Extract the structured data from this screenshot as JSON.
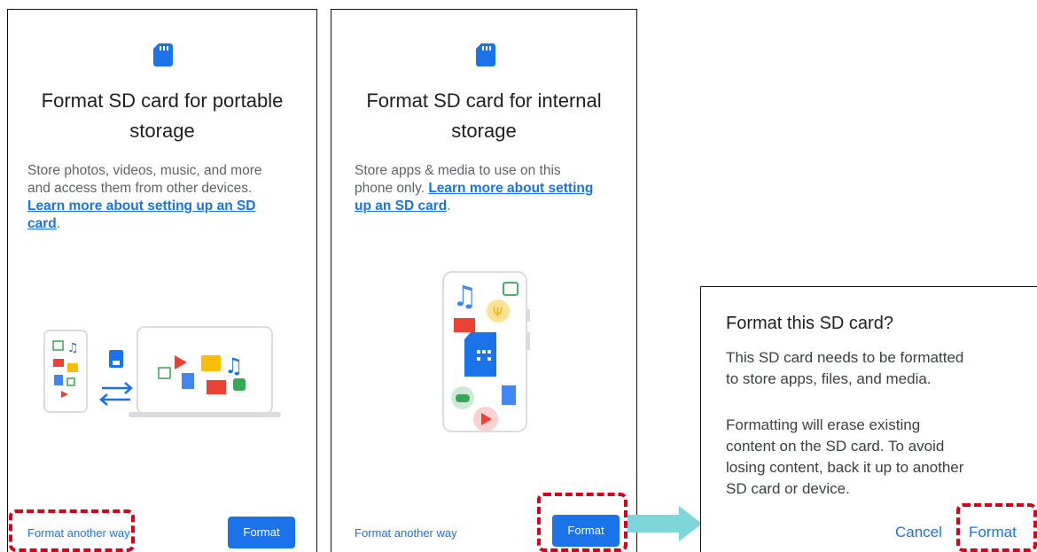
{
  "panels": {
    "portable": {
      "title_line1": "Format SD card for portable",
      "title_line2": "storage",
      "body_lines": [
        "Store photos, videos, music, and more",
        "and access them from other devices."
      ],
      "link_line1": "Learn more about setting up an SD",
      "link_line2": "card",
      "period": ".",
      "secondary_button": "Format another way",
      "primary_button": "Format"
    },
    "internal": {
      "title_line1": "Format SD card for internal",
      "title_line2": "storage",
      "body_line1": "Store apps & media to use on this",
      "body_line2_prefix": "phone only. ",
      "link_line1": "Learn more about setting",
      "link_line2": "up an SD card",
      "period": ".",
      "secondary_button": "Format another way",
      "primary_button": "Format"
    },
    "dialog": {
      "title": "Format this SD card?",
      "para1_lines": [
        "This SD card needs to be formatted",
        "to store apps, files, and media."
      ],
      "para2_lines": [
        "Formatting will erase existing",
        "content on the SD card. To avoid",
        "losing content, back it up to another",
        "SD card or device."
      ],
      "cancel_button": "Cancel",
      "format_button": "Format"
    }
  },
  "colors": {
    "accent": "#1a73e8",
    "highlight": "#d9001b",
    "arrow": "#7fd6da"
  },
  "icons": [
    "sd-card-icon",
    "music-note-icon",
    "image-icon",
    "folder-icon",
    "document-icon",
    "play-icon",
    "gamepad-icon",
    "restaurant-icon",
    "video-clip-icon",
    "transfer-arrows-icon"
  ]
}
